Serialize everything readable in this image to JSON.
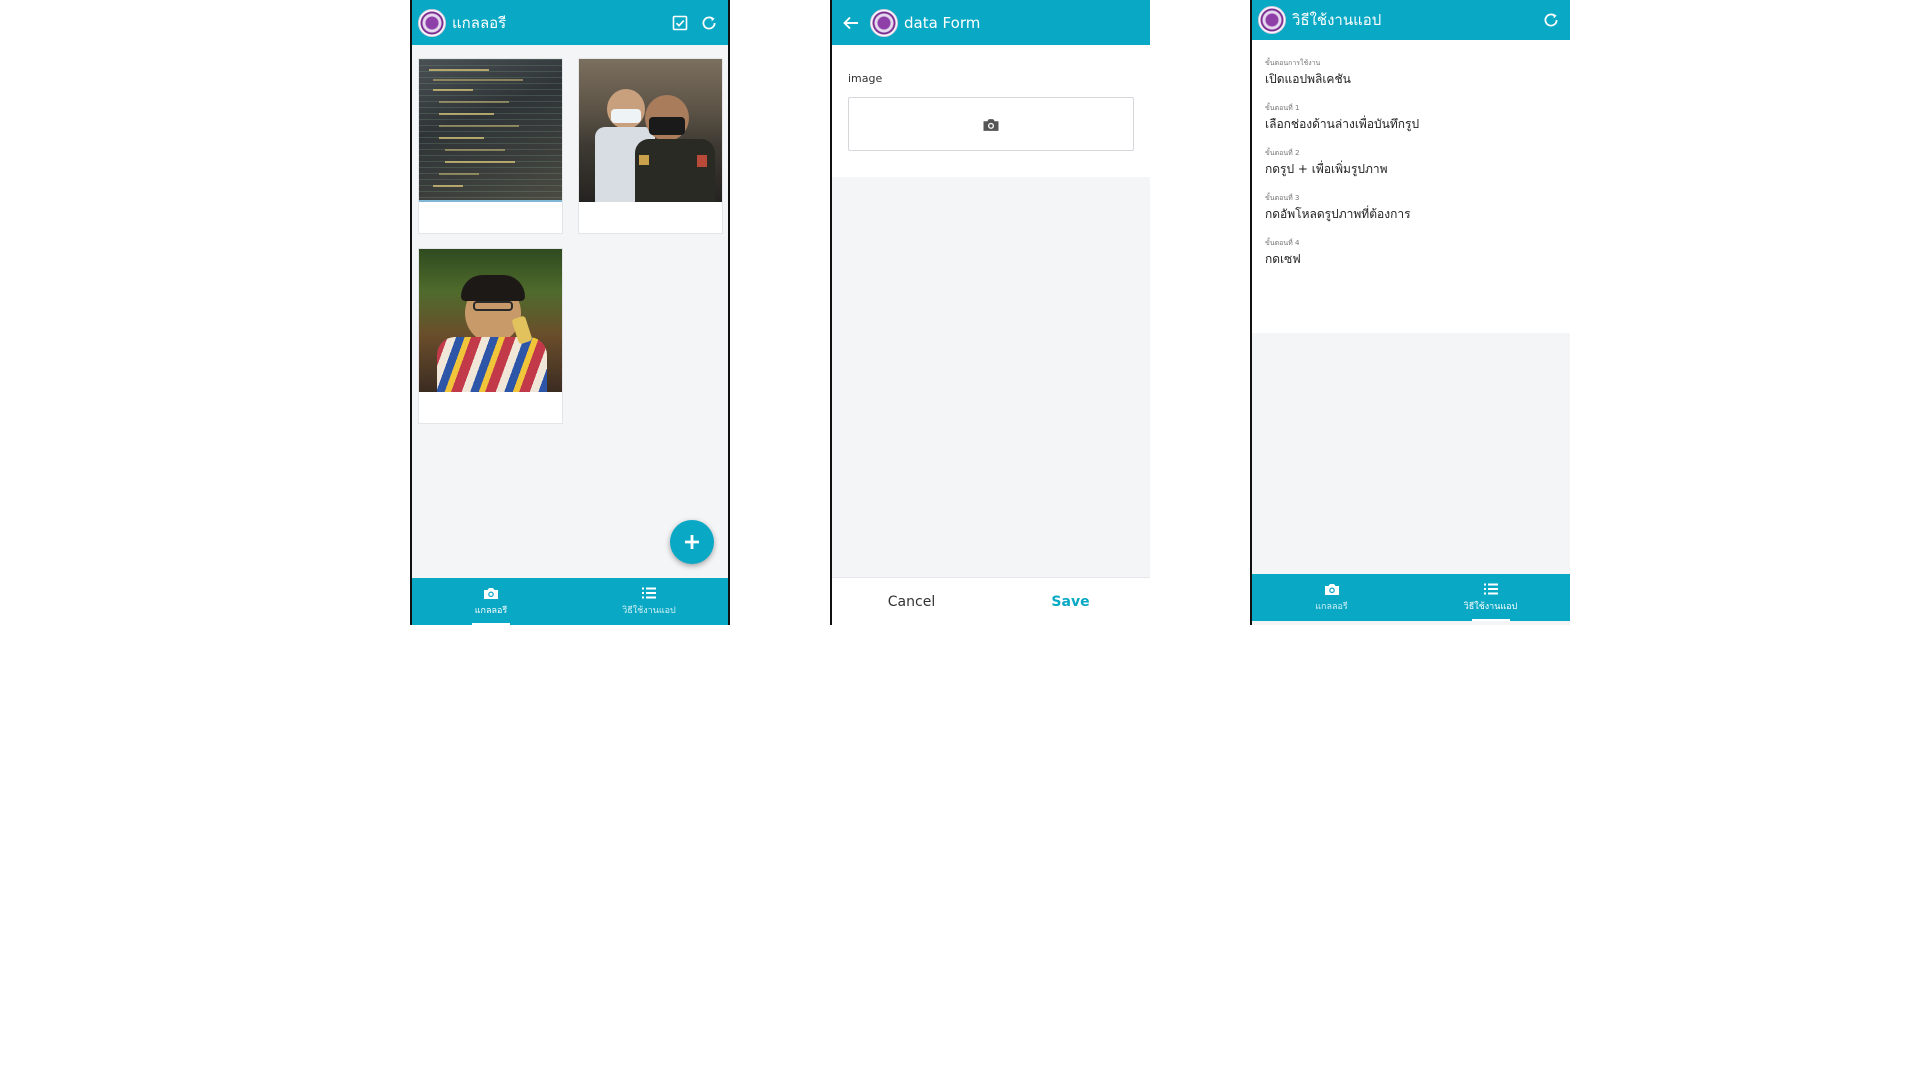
{
  "colors": {
    "primary": "#09a8c4",
    "background": "#f4f5f7",
    "save": "#09a8c4"
  },
  "gallery": {
    "title": "แกลลอรี",
    "actions": [
      {
        "icon": "checkbox-check-icon"
      },
      {
        "icon": "refresh-icon"
      }
    ],
    "photos": [
      {
        "subject": "computer-screen-code"
      },
      {
        "subject": "two-people-masks"
      },
      {
        "subject": "child-selfie"
      }
    ],
    "fab": {
      "icon": "plus-icon"
    }
  },
  "bottom_nav": {
    "tabs": [
      {
        "label": "แกลลอรี",
        "icon": "camera-icon"
      },
      {
        "label": "วิธีใช้งานแอป",
        "icon": "list-icon"
      }
    ]
  },
  "form": {
    "title": "data Form",
    "field_label": "image",
    "cancel_label": "Cancel",
    "save_label": "Save"
  },
  "howto": {
    "title": "วิธีใช้งานแอป",
    "steps": [
      {
        "label": "ขั้นตอนการใช้งาน",
        "text": "เปิดแอปพลิเคชัน"
      },
      {
        "label": "ขั้นตอนที่ 1",
        "text": "เลือกช่องด้านล่างเพื่อบันทึกรูป"
      },
      {
        "label": "ขั้นตอนที่ 2",
        "text": "กดรูป + เพื่อเพิ่มรูปภาพ"
      },
      {
        "label": "ขั้นตอนที่ 3",
        "text": "กดอัพโหลดรูปภาพที่ต้องการ"
      },
      {
        "label": "ขั้นตอนที่ 4",
        "text": "กดเซฟ"
      }
    ]
  }
}
